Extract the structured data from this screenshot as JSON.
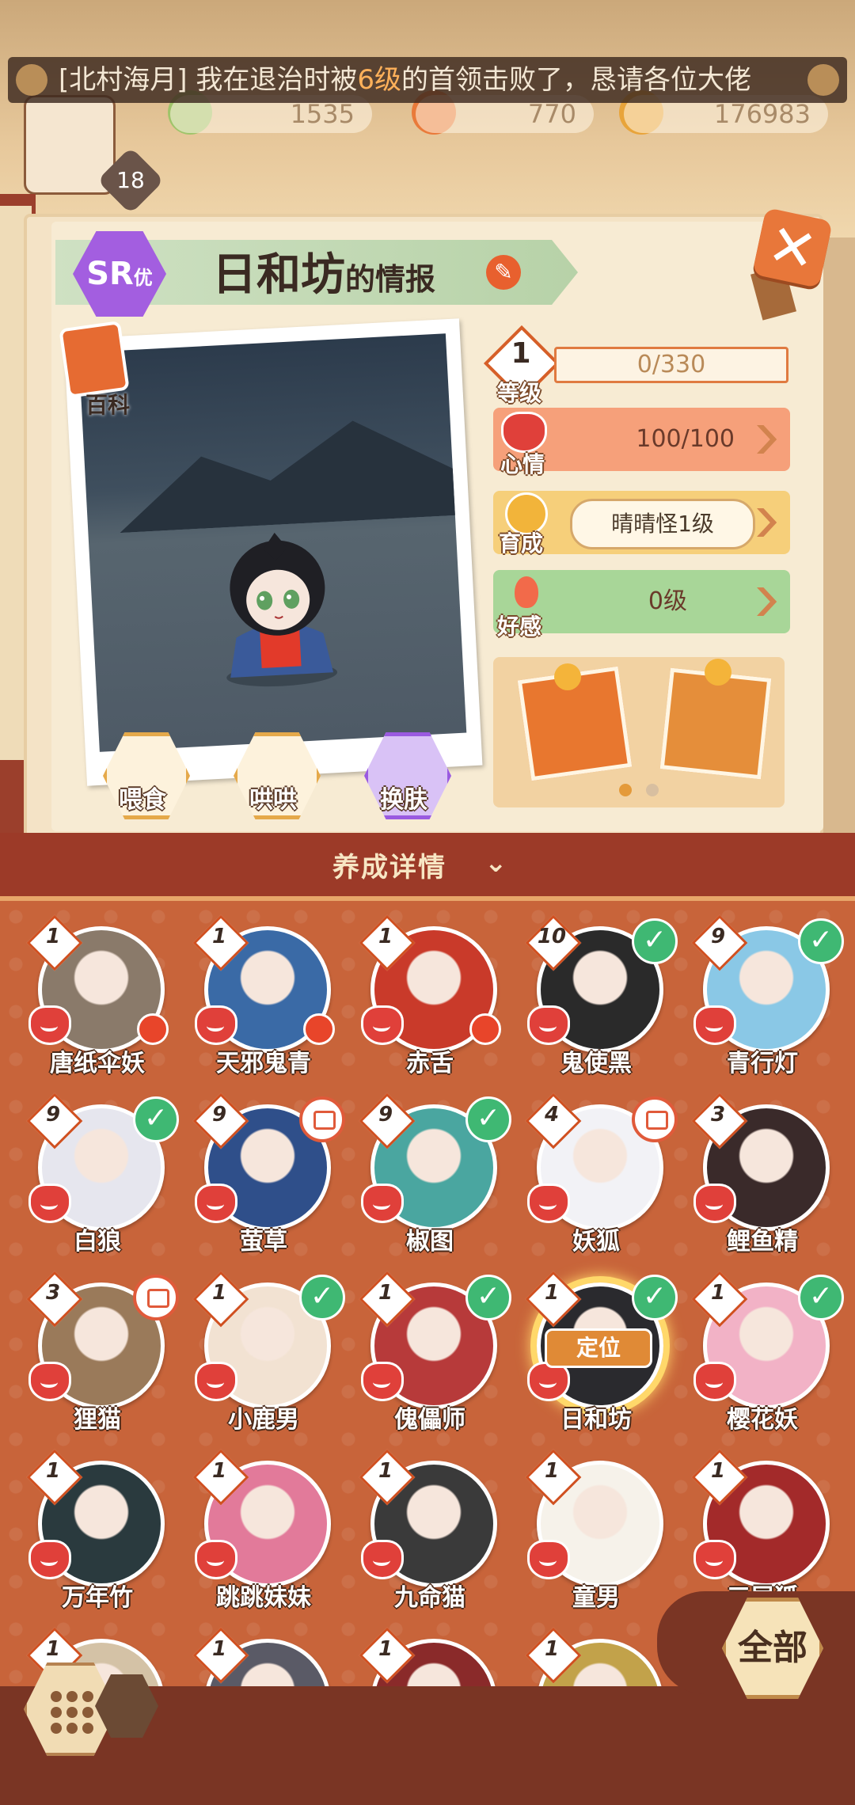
{
  "marquee": {
    "prefix": "[北村海月] 我在退治时被",
    "highlight": "6级",
    "suffix": "的首领击败了，恳请各位大佬"
  },
  "resources": {
    "player_level": "18",
    "jade": "1535",
    "stamina": "770",
    "coins": "176983"
  },
  "profile": {
    "rarity": "SR",
    "rarity_sub": "优",
    "name": "日和坊",
    "title_suffix": "的情报",
    "encyclopedia_label": "百科",
    "level": "1",
    "level_label": "等级",
    "exp": "0/330",
    "mood_label": "心情",
    "mood": "100/100",
    "grow_label": "育成",
    "grow_value": "晴晴怪1级",
    "fav_label": "好感",
    "fav_value": "0级",
    "actions": [
      "喂食",
      "哄哄",
      "换肤"
    ]
  },
  "nurture_header": "养成详情",
  "roster": [
    {
      "name": "唐纸伞妖",
      "level": "1",
      "status": "red-dot",
      "color": "#8a7a6a"
    },
    {
      "name": "天邪鬼青",
      "level": "1",
      "status": "red-dot",
      "color": "#3a6aa6"
    },
    {
      "name": "赤舌",
      "level": "1",
      "status": "red-dot",
      "color": "#c93a2a"
    },
    {
      "name": "鬼使黑",
      "level": "10",
      "status": "check",
      "color": "#2a2a2a"
    },
    {
      "name": "青行灯",
      "level": "9",
      "status": "check",
      "color": "#8ac8e6"
    },
    {
      "name": "白狼",
      "level": "9",
      "status": "check",
      "color": "#e6e6ee"
    },
    {
      "name": "萤草",
      "level": "9",
      "status": "bubble",
      "color": "#2f4f8a"
    },
    {
      "name": "椒图",
      "level": "9",
      "status": "check",
      "color": "#4aa6a0"
    },
    {
      "name": "妖狐",
      "level": "4",
      "status": "bubble",
      "color": "#f2f2f6"
    },
    {
      "name": "鲤鱼精",
      "level": "3",
      "status": "none",
      "color": "#3a2a2a"
    },
    {
      "name": "狸猫",
      "level": "3",
      "status": "bubble",
      "color": "#9a7a5a"
    },
    {
      "name": "小鹿男",
      "level": "1",
      "status": "check",
      "color": "#f2e2d2"
    },
    {
      "name": "傀儡师",
      "level": "1",
      "status": "check",
      "color": "#b73a3a"
    },
    {
      "name": "日和坊",
      "level": "1",
      "status": "check",
      "color": "#2a2a2e",
      "locate": "定位"
    },
    {
      "name": "樱花妖",
      "level": "1",
      "status": "check",
      "color": "#f2b2c6"
    },
    {
      "name": "万年竹",
      "level": "1",
      "status": "none",
      "color": "#2a3a3e"
    },
    {
      "name": "跳跳妹妹",
      "level": "1",
      "status": "none",
      "color": "#e27a9a"
    },
    {
      "name": "九命猫",
      "level": "1",
      "status": "none",
      "color": "#3a3a3a"
    },
    {
      "name": "童男",
      "level": "1",
      "status": "none",
      "color": "#f6f2ea"
    },
    {
      "name": "三尾狐",
      "level": "1",
      "status": "none",
      "color": "#a32a2a"
    },
    {
      "name": "",
      "level": "1",
      "status": "none",
      "color": "#d4c2a6"
    },
    {
      "name": "",
      "level": "1",
      "status": "none",
      "color": "#5a5a66"
    },
    {
      "name": "",
      "level": "1",
      "status": "none",
      "color": "#8a2a2a"
    },
    {
      "name": "",
      "level": "1",
      "status": "none",
      "color": "#c2a24a"
    }
  ],
  "bottom": {
    "all_label": "全部"
  },
  "colors": {
    "accent_orange": "#e8602e",
    "grid_bg": "#c8643a",
    "check_green": "#3fb873"
  }
}
